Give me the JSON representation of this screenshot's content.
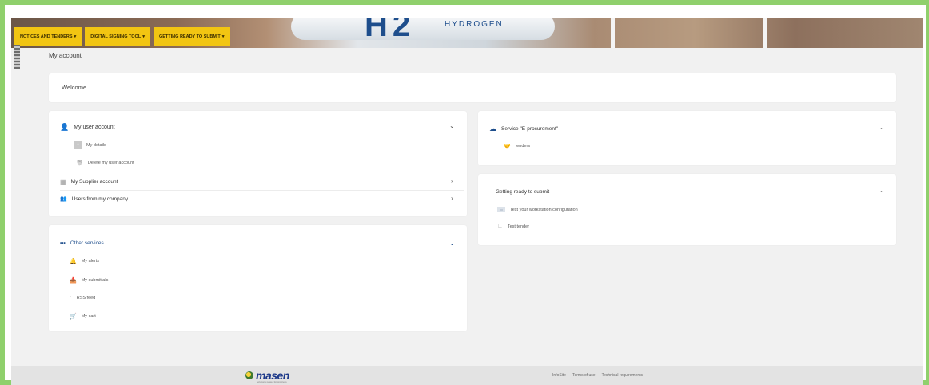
{
  "nav": {
    "tabs": [
      {
        "label": "NOTICES AND TENDERS"
      },
      {
        "label": "DIGITAL SIGNING TOOL"
      },
      {
        "label": "GETTING READY TO SUBMIT"
      }
    ]
  },
  "banner": {
    "h2": "H2",
    "hydrogen": "HYDROGEN"
  },
  "page": {
    "title": "My account",
    "welcome": "Welcome"
  },
  "account": {
    "title": "My user account",
    "items": [
      "My details",
      "Delete my user account"
    ],
    "supplier": "My Supplier account",
    "users": "Users from my company"
  },
  "other": {
    "title": "Other services",
    "items": [
      "My alerts",
      "My submittals",
      "RSS feed",
      "My cart"
    ]
  },
  "eproc": {
    "title": "Service \"E-procurement\"",
    "items": [
      "tenders"
    ]
  },
  "ready": {
    "title": "Getting ready to submit",
    "items": [
      "Test your workstation configuration",
      "Test tender"
    ]
  },
  "footer": {
    "logo": "masen",
    "tagline": "solutions power for progress",
    "links": [
      "InfoSite",
      "Terms of use",
      "Technical requirements"
    ]
  },
  "icons": {
    "user": "user-icon",
    "details": "id-card-icon",
    "trash": "trash-icon",
    "building": "building-icon",
    "users": "users-icon",
    "dots": "more-dots-icon",
    "bell": "bell-icon",
    "inbox": "inbox-icon",
    "rss": "rss-icon",
    "cart": "cart-icon",
    "cloud": "cloud-upload-icon",
    "handshake": "handshake-icon",
    "monitor": "monitor-icon",
    "chart": "chart-icon"
  },
  "colors": {
    "nav": "#f2c512",
    "frame": "#8fd06c",
    "accent": "#1e4e8c"
  }
}
